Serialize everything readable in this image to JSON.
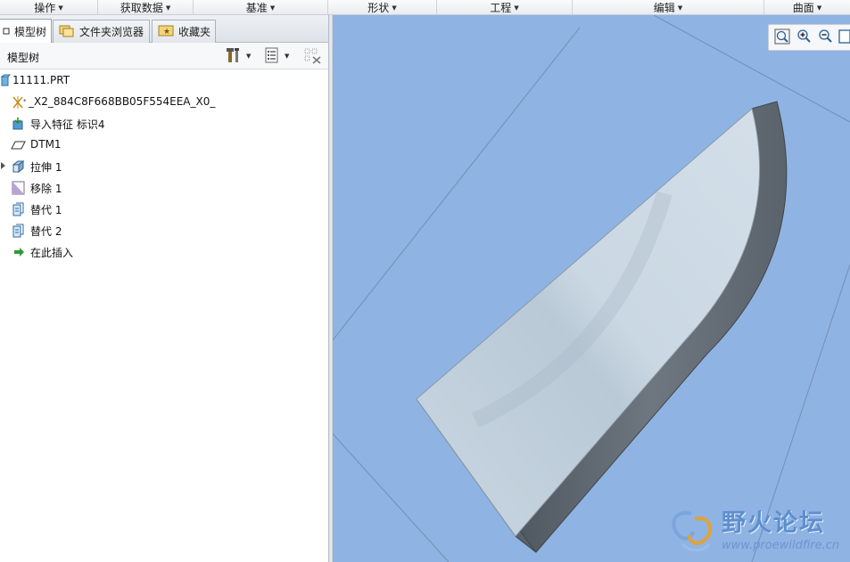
{
  "ribbon": {
    "groups": [
      "操作",
      "获取数据",
      "基准",
      "形状",
      "工程",
      "编辑",
      "曲面"
    ]
  },
  "panel": {
    "tabs": [
      {
        "label": "模型树",
        "icon": "model-tree-icon"
      },
      {
        "label": "文件夹浏览器",
        "icon": "folder-browser-icon"
      },
      {
        "label": "收藏夹",
        "icon": "favorites-icon"
      }
    ],
    "header_title": "模型树",
    "header_tools": [
      "settings-icon",
      "show-icon",
      "filter-icon"
    ]
  },
  "tree": {
    "items": [
      {
        "label": "11111.PRT",
        "icon": "part-icon"
      },
      {
        "label": "_X2_884C8F668BB05F554EEA_X0_",
        "icon": "csys-icon"
      },
      {
        "label": "导入特征 标识4",
        "icon": "import-feature-icon"
      },
      {
        "label": "DTM1",
        "icon": "datum-plane-icon"
      },
      {
        "label": "拉伸 1",
        "icon": "extrude-icon"
      },
      {
        "label": "移除 1",
        "icon": "remove-icon"
      },
      {
        "label": "替代 1",
        "icon": "replace-icon"
      },
      {
        "label": "替代 2",
        "icon": "replace-icon"
      },
      {
        "label": "在此插入",
        "icon": "insert-here-icon"
      }
    ]
  },
  "viewport": {
    "background": "#8fb3e3",
    "view_tools": [
      "zoom-fit-icon",
      "zoom-in-icon",
      "zoom-out-icon",
      "refit-icon"
    ]
  },
  "watermark": {
    "title": "野火论坛",
    "url": "www.proewildfire.cn"
  }
}
